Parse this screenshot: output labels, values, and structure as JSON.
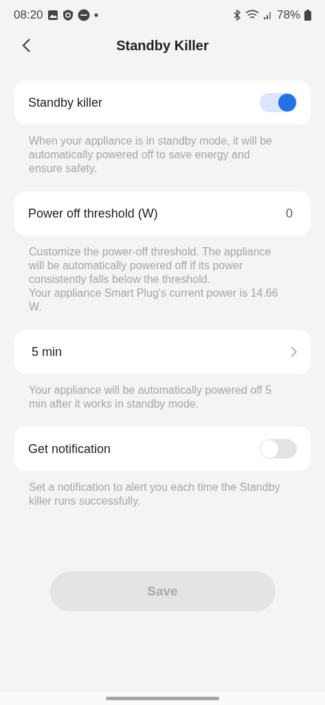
{
  "status_bar": {
    "time": "08:20",
    "battery": "78%"
  },
  "header": {
    "title": "Standby Killer"
  },
  "sections": [
    {
      "kind": "toggle",
      "label": "Standby killer",
      "on": true,
      "description": "When your appliance is in standby mode, it will be automatically powered off to save energy and ensure safety."
    },
    {
      "kind": "value",
      "label": "Power off threshold (W)",
      "value": "0",
      "description": "Customize the power-off threshold. The appliance will be automatically powered off if its power consistently falls below the threshold.\nYour appliance Smart Plug's current power is 14.66 W."
    },
    {
      "kind": "nav",
      "label": "5 min",
      "description": "Your appliance will be automatically powered off  5 min after it works in standby mode."
    },
    {
      "kind": "toggle",
      "label": "Get notification",
      "on": false,
      "description": "Set a notification to alert you each time the Standby killer runs successfully."
    }
  ],
  "save_button": {
    "label": "Save",
    "disabled": true
  }
}
